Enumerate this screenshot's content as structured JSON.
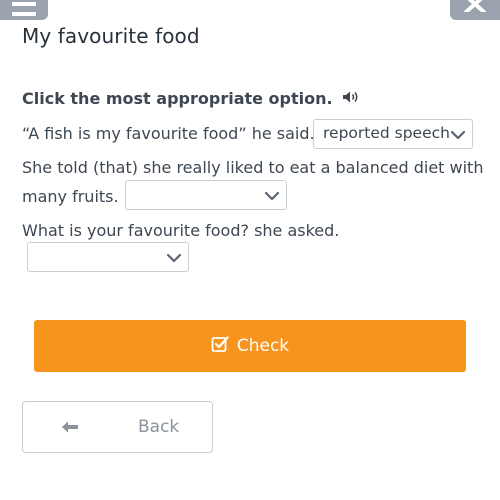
{
  "header": {
    "menu_icon": "hamburger-menu-icon",
    "close_icon": "close-icon"
  },
  "title": "My favourite food",
  "instruction": {
    "text": "Click the most appropriate option.",
    "icon": "speaker-icon"
  },
  "questions": [
    {
      "text": "“A fish is my favourite food” he said.",
      "selected": "reported speech"
    },
    {
      "text_line1": "She told (that) she really liked to eat a balanced diet with",
      "text_line2": "many fruits.",
      "selected": ""
    },
    {
      "text": "What is your favourite food? she asked.",
      "selected": ""
    }
  ],
  "buttons": {
    "check_label": "Check",
    "back_label": "Back"
  },
  "colors": {
    "accent": "#f7941d",
    "header_button": "#9aa3ad",
    "text": "#3d4752"
  }
}
